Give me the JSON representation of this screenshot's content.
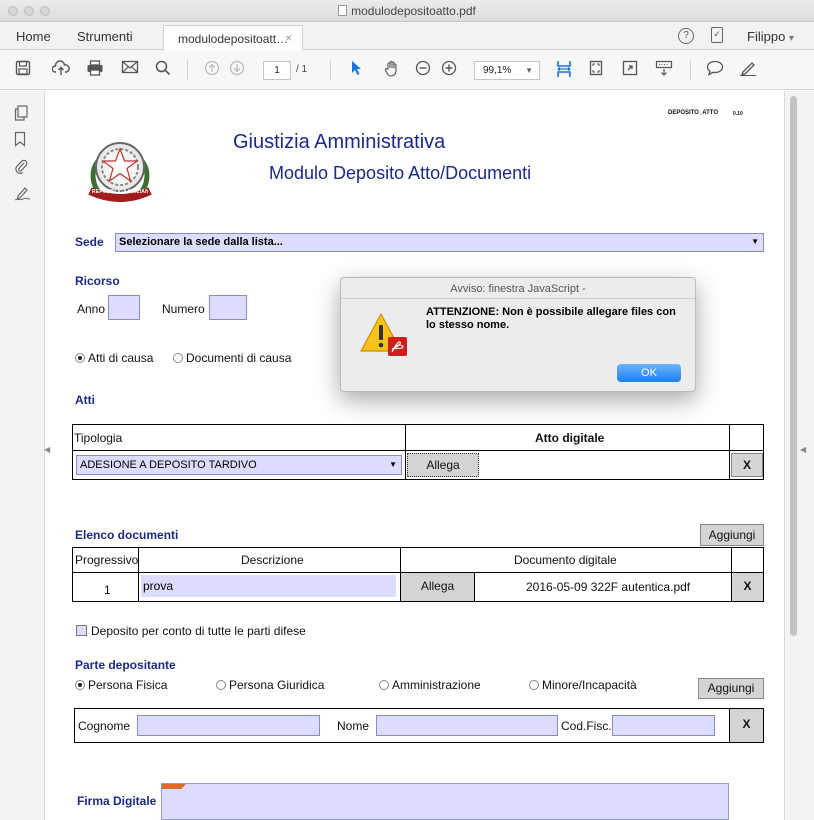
{
  "window": {
    "title": "modulodepositoatto.pdf"
  },
  "menubar": {
    "home": "Home",
    "tools": "Strumenti",
    "doc_tab": "modulodepositoatt…",
    "tab_close": "×",
    "user": "Filippo",
    "user_arrow": "▾"
  },
  "toolbar": {
    "page_current": "1",
    "page_total": "/ 1",
    "zoom": "99,1%"
  },
  "form": {
    "code": "DEPOSITO_ATTO",
    "version": "0.10",
    "title": "Giustizia Amministrativa",
    "subtitle": "Modulo Deposito Atto/Documenti",
    "emblem_text": "REPUBBLICA ITALIANA",
    "sede_label": "Sede",
    "sede_value": "Selezionare la sede dalla lista...",
    "ricorso_label": "Ricorso",
    "anno_label": "Anno",
    "numero_label": "Numero",
    "radio_atti": "Atti di causa",
    "radio_documenti": "Documenti di causa",
    "atti_label": "Atti",
    "tipologia_header": "Tipologia",
    "atto_digitale_header": "Atto digitale",
    "tipologia_value": "ADESIONE A DEPOSITO TARDIVO",
    "allega": "Allega",
    "x": "X",
    "elenco_label": "Elenco documenti",
    "aggiungi": "Aggiungi",
    "progressivo_header": "Progressivo",
    "descrizione_header": "Descrizione",
    "documento_header": "Documento digitale",
    "row_num": "1",
    "row_desc": "prova",
    "row_file": "2016-05-09 322F autentica.pdf",
    "deposito_check": "Deposito per conto di tutte le parti difese",
    "parte_label": "Parte depositante",
    "pf": "Persona Fisica",
    "pg": "Persona Giuridica",
    "amm": "Amministrazione",
    "min": "Minore/Incapacità",
    "cognome": "Cognome",
    "nome": "Nome",
    "codfisc": "Cod.Fisc.",
    "firma_label": "Firma Digitale"
  },
  "dialog": {
    "title": "Avviso: finestra JavaScript -",
    "message_bold": "ATTENZIONE:",
    "message": " Non è possibile allegare files con lo stesso nome.",
    "ok": "OK"
  }
}
